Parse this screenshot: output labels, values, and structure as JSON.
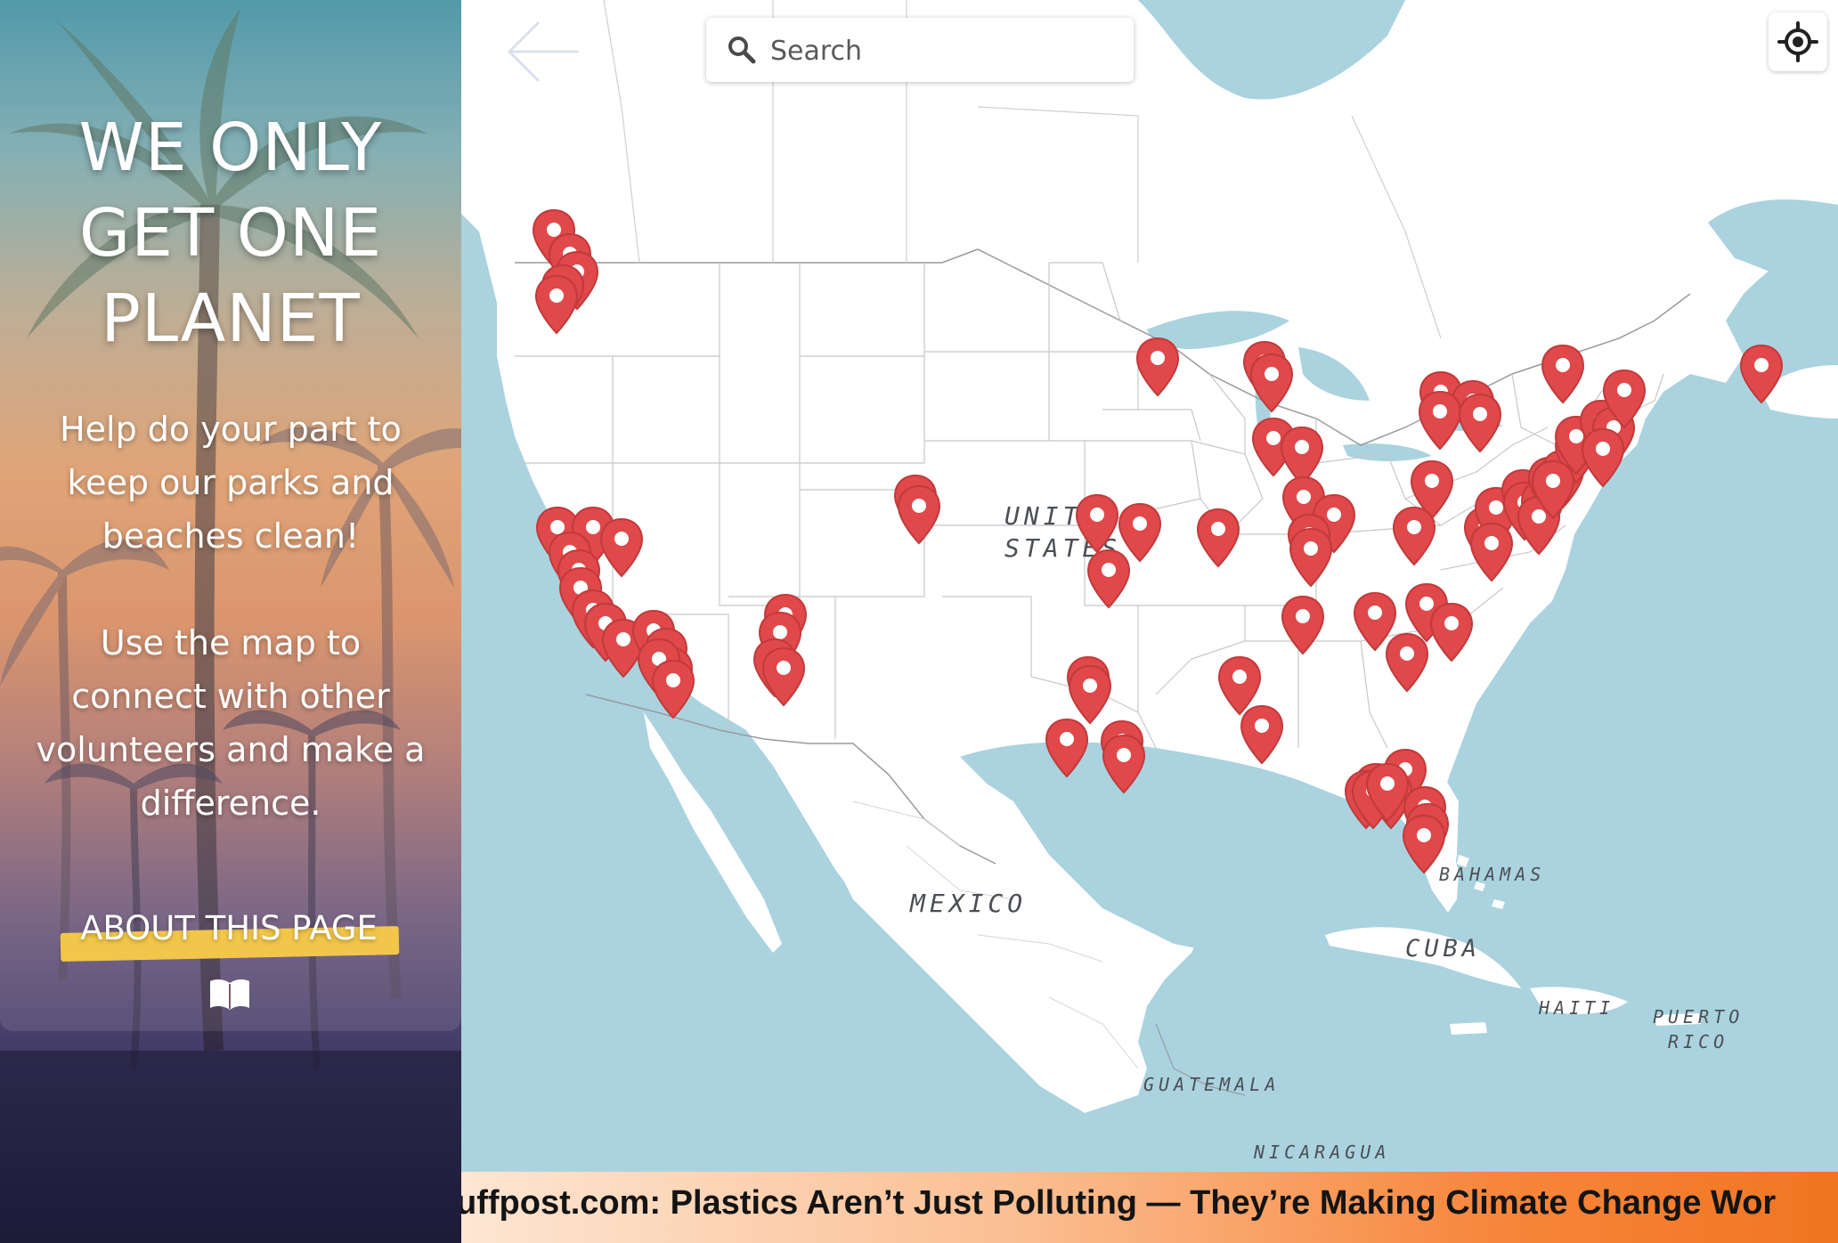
{
  "sidebar": {
    "title": "WE ONLY\nGET ONE\nPLANET",
    "intro": "Help do your part to\nkeep our parks and\nbeaches clean!",
    "instructions": "Use the map to\nconnect with other\nvolunteers and make a\ndifference.",
    "about_label": "ABOUT THIS PAGE",
    "about_icon": "book-icon",
    "accent_color": "#f2c64a"
  },
  "search": {
    "placeholder": "Search",
    "value": ""
  },
  "toolbar": {
    "back_icon": "arrow-left-icon",
    "locate_icon": "crosshair-icon"
  },
  "map": {
    "water_color": "#aad3df",
    "land_color": "#ffffff",
    "marker_color": "#e0484a",
    "labels": {
      "united_states": "UNITED\nSTATES",
      "mexico": "MEXICO",
      "cuba": "CUBA",
      "bahamas": "BAHAMAS",
      "haiti": "HAITI",
      "puerto_rico": "PUERTO\nRICO",
      "guatemala": "GUATEMALA",
      "nicaragua": "NICARAGUA"
    }
  },
  "ticker": {
    "text": "uffpost.com: Plastics Aren’t Just Polluting — They’re Making Climate Change Wor"
  }
}
